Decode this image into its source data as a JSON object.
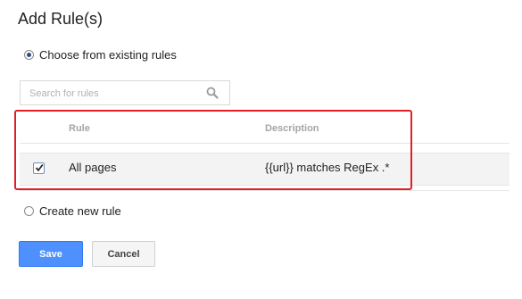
{
  "dialog": {
    "title": "Add Rule(s)"
  },
  "options": {
    "existing_label": "Choose from existing rules",
    "existing_selected": true,
    "new_label": "Create new rule",
    "new_selected": false
  },
  "search": {
    "placeholder": "Search for rules",
    "value": ""
  },
  "table": {
    "headers": [
      "Rule",
      "Description"
    ],
    "rows": [
      {
        "checked": true,
        "rule": "All pages",
        "description": "{{url}} matches RegEx .*"
      }
    ]
  },
  "actions": {
    "save_label": "Save",
    "cancel_label": "Cancel"
  },
  "colors": {
    "highlight_border": "#e12026",
    "primary_button": "#4d90fe"
  }
}
